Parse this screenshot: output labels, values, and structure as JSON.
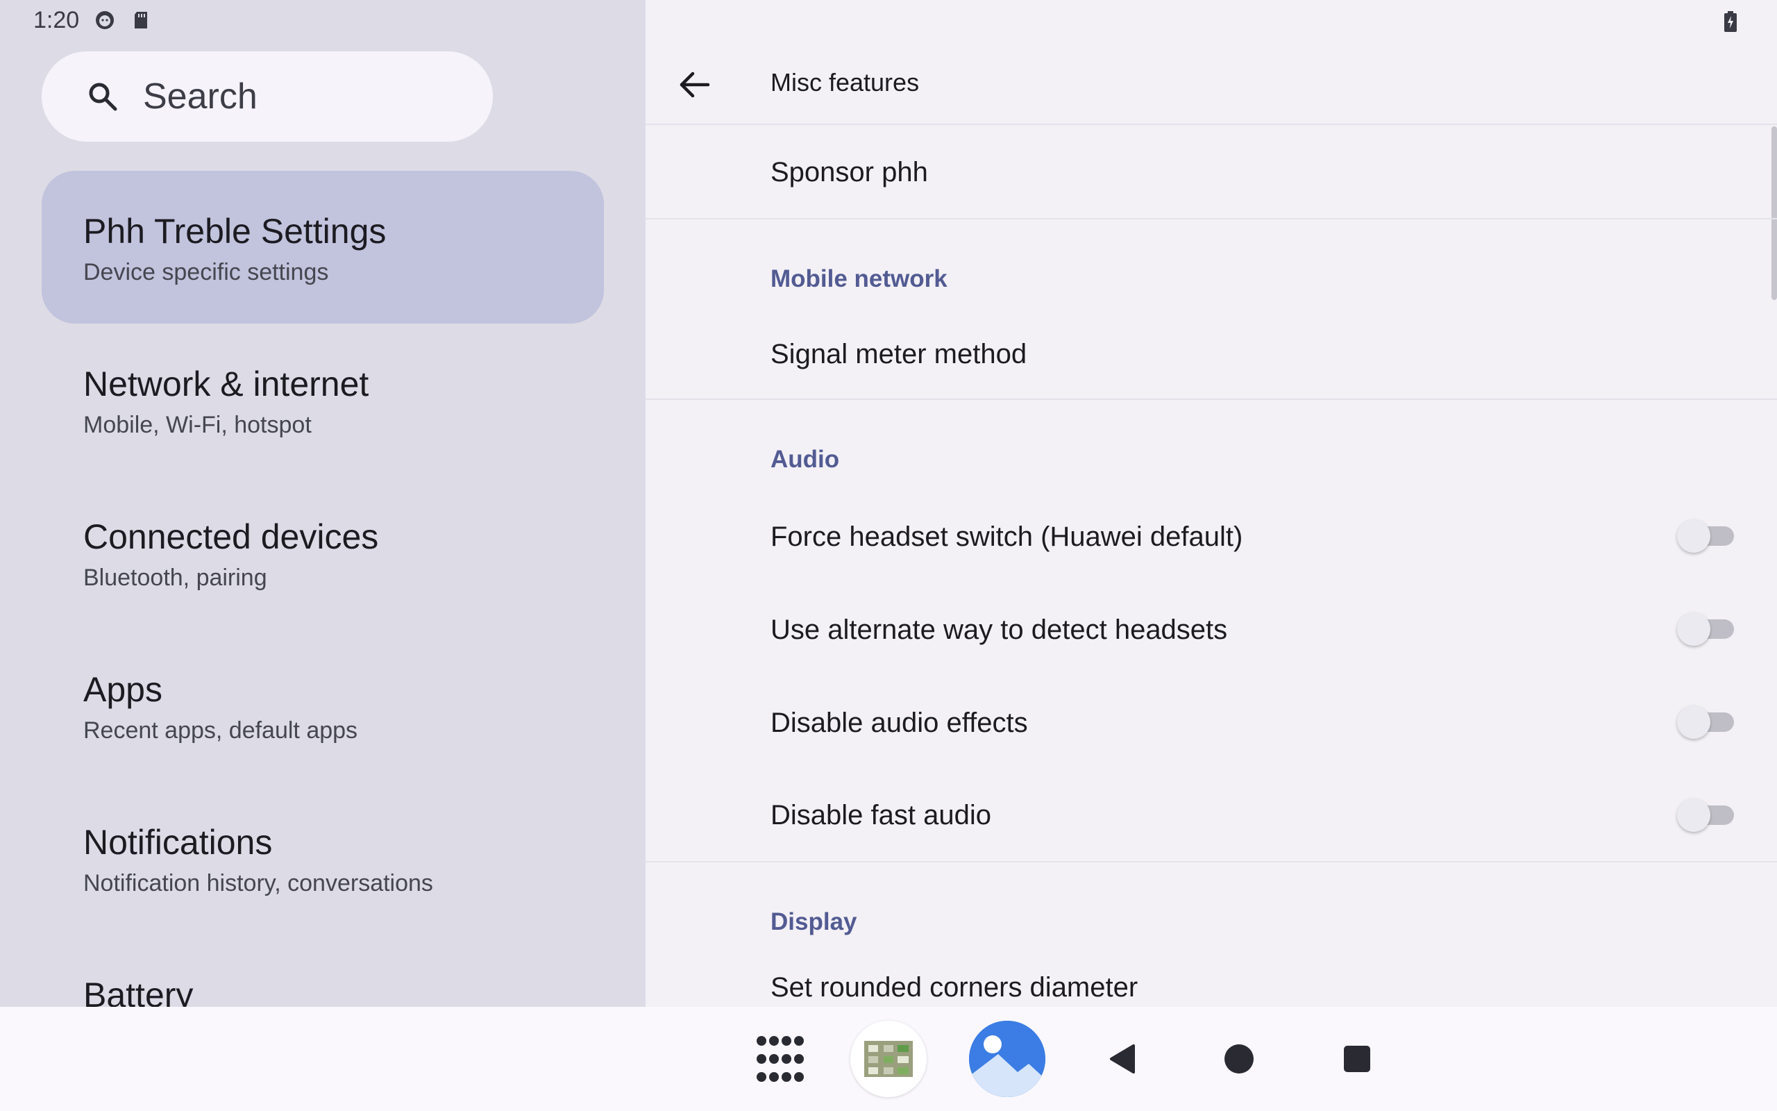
{
  "status": {
    "time": "1:20"
  },
  "search": {
    "placeholder": "Search"
  },
  "left_menu": [
    {
      "title": "Phh Treble Settings",
      "subtitle": "Device specific settings",
      "selected": true
    },
    {
      "title": "Network & internet",
      "subtitle": "Mobile, Wi-Fi, hotspot"
    },
    {
      "title": "Connected devices",
      "subtitle": "Bluetooth, pairing"
    },
    {
      "title": "Apps",
      "subtitle": "Recent apps, default apps"
    },
    {
      "title": "Notifications",
      "subtitle": "Notification history, conversations"
    },
    {
      "title": "Battery",
      "subtitle": ""
    }
  ],
  "topbar": {
    "title": "Misc features"
  },
  "content": {
    "sponsor": "Sponsor phh",
    "mobile_network": {
      "header": "Mobile network",
      "signal_meter": "Signal meter method"
    },
    "audio": {
      "header": "Audio",
      "items": [
        {
          "label": "Force headset switch (Huawei default)",
          "on": false
        },
        {
          "label": "Use alternate way to detect headsets",
          "on": false
        },
        {
          "label": "Disable audio effects",
          "on": false
        },
        {
          "label": "Disable fast audio",
          "on": false
        }
      ]
    },
    "display": {
      "header": "Display",
      "rounded_corners": "Set rounded corners diameter"
    }
  },
  "colors": {
    "accent": "#525b92",
    "selected_bg": "#c2c3dd",
    "left_bg": "#dddce6",
    "right_bg": "#f3f1f6"
  }
}
